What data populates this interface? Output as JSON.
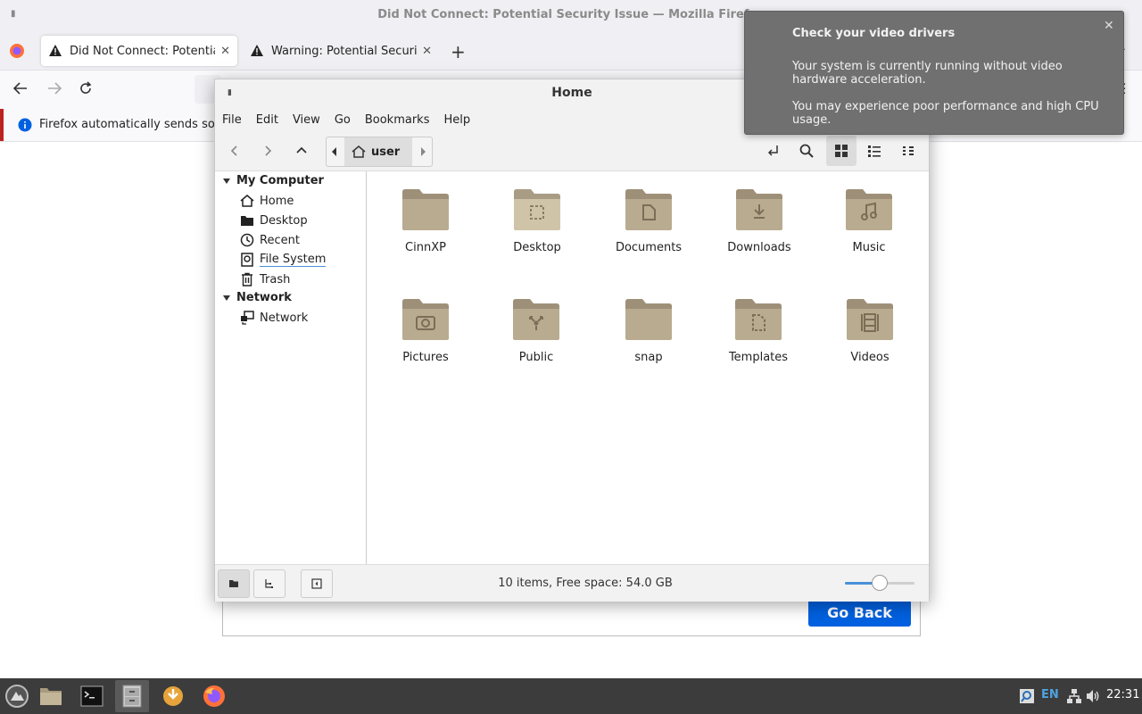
{
  "firefox": {
    "window_title": "Did Not Connect: Potential Security Issue — Mozilla Firefox",
    "tabs": [
      {
        "label": "Did Not Connect: Potential Security Issue",
        "active": true
      },
      {
        "label": "Warning: Potential Security Risk Ahead",
        "active": false
      }
    ],
    "info_message": "Firefox automatically sends some",
    "go_back_label": "Go Back",
    "accent_color": "#0061e0"
  },
  "file_manager": {
    "title": "Home",
    "menu": [
      "File",
      "Edit",
      "View",
      "Go",
      "Bookmarks",
      "Help"
    ],
    "breadcrumb": "user",
    "sidebar": {
      "sections": [
        {
          "title": "My Computer",
          "items": [
            {
              "label": "Home",
              "icon": "home-icon"
            },
            {
              "label": "Desktop",
              "icon": "desktop-folder-icon"
            },
            {
              "label": "Recent",
              "icon": "recent-clock-icon"
            },
            {
              "label": "File System",
              "icon": "drive-icon"
            },
            {
              "label": "Trash",
              "icon": "trash-icon"
            }
          ]
        },
        {
          "title": "Network",
          "items": [
            {
              "label": "Network",
              "icon": "network-icon"
            }
          ]
        }
      ]
    },
    "files": [
      {
        "name": "CinnXP",
        "icon": "folder-icon"
      },
      {
        "name": "Desktop",
        "icon": "folder-desktop-icon"
      },
      {
        "name": "Documents",
        "icon": "folder-documents-icon"
      },
      {
        "name": "Downloads",
        "icon": "folder-downloads-icon"
      },
      {
        "name": "Music",
        "icon": "folder-music-icon"
      },
      {
        "name": "Pictures",
        "icon": "folder-pictures-icon"
      },
      {
        "name": "Public",
        "icon": "folder-public-icon"
      },
      {
        "name": "snap",
        "icon": "folder-icon"
      },
      {
        "name": "Templates",
        "icon": "folder-templates-icon"
      },
      {
        "name": "Videos",
        "icon": "folder-videos-icon"
      }
    ],
    "status": "10 items, Free space: 54.0 GB",
    "zoom_level": 0.5,
    "folder_color": "#b8ab8f"
  },
  "notification": {
    "title": "Check your video drivers",
    "line1": "Your system is currently running without video hardware acceleration.",
    "line2": "You may experience poor performance and high CPU usage."
  },
  "taskbar": {
    "language": "EN",
    "clock": "22:31"
  }
}
